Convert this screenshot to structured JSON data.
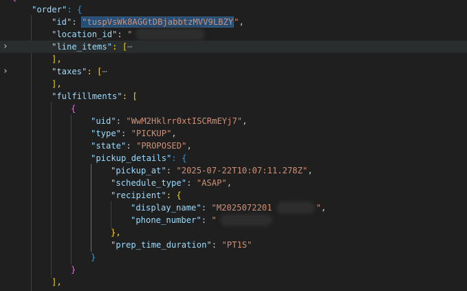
{
  "editor": {
    "lines": {
      "l0": {
        "text": "{"
      },
      "l1": {
        "key": "\"order\"",
        "punc": ": {"
      },
      "l2": {
        "key": "\"id\"",
        "sep": ": ",
        "val_selected": "\"tuspVsWk8AGGtDBjabbtzMVV9LBZY",
        "val_tail": "\"",
        "end": ","
      },
      "l3": {
        "key": "\"location_id\"",
        "sep": ": ",
        "val": "\""
      },
      "l4": {
        "key": "\"line_items\"",
        "punc": ": [",
        "ellipsis": "⋯"
      },
      "l5": {
        "punc": "],"
      },
      "l6": {
        "key": "\"taxes\"",
        "punc": ": [",
        "ellipsis": "⋯"
      },
      "l7": {
        "punc": "],"
      },
      "l8": {
        "key": "\"fulfillments\"",
        "punc": ": ["
      },
      "l9": {
        "brace": "{"
      },
      "l10": {
        "key": "\"uid\"",
        "sep": ": ",
        "val": "\"WwM2Hklrr0xtISCRmEYj7\"",
        "end": ","
      },
      "l11": {
        "key": "\"type\"",
        "sep": ": ",
        "val": "\"PICKUP\"",
        "end": ","
      },
      "l12": {
        "key": "\"state\"",
        "sep": ": ",
        "val": "\"PROPOSED\"",
        "end": ","
      },
      "l13": {
        "key": "\"pickup_details\"",
        "punc": ": {"
      },
      "l14": {
        "key": "\"pickup_at\"",
        "sep": ": ",
        "val": "\"2025-07-22T10:07:11.278Z\"",
        "end": ","
      },
      "l15": {
        "key": "\"schedule_type\"",
        "sep": ": ",
        "val": "\"ASAP\"",
        "end": ","
      },
      "l16": {
        "key": "\"recipient\"",
        "punc": ": {"
      },
      "l17": {
        "key": "\"display_name\"",
        "sep": ": ",
        "val": "\"M2025072201",
        "val_tail": "\"",
        "end": ","
      },
      "l18": {
        "key": "\"phone_number\"",
        "sep": ": ",
        "val": "\""
      },
      "l19": {
        "punc": "},"
      },
      "l20": {
        "key": "\"prep_time_duration\"",
        "sep": ": ",
        "val": "\"PT1S\""
      },
      "l21": {
        "punc": "}"
      },
      "l22": {
        "brace": "}"
      },
      "l23": {
        "punc": "],"
      }
    },
    "folding_chevron": "›",
    "colors": {
      "background": "#1f1f1f",
      "key": "#9cdcfe",
      "string": "#ce9178",
      "selection": "#264f78"
    }
  }
}
